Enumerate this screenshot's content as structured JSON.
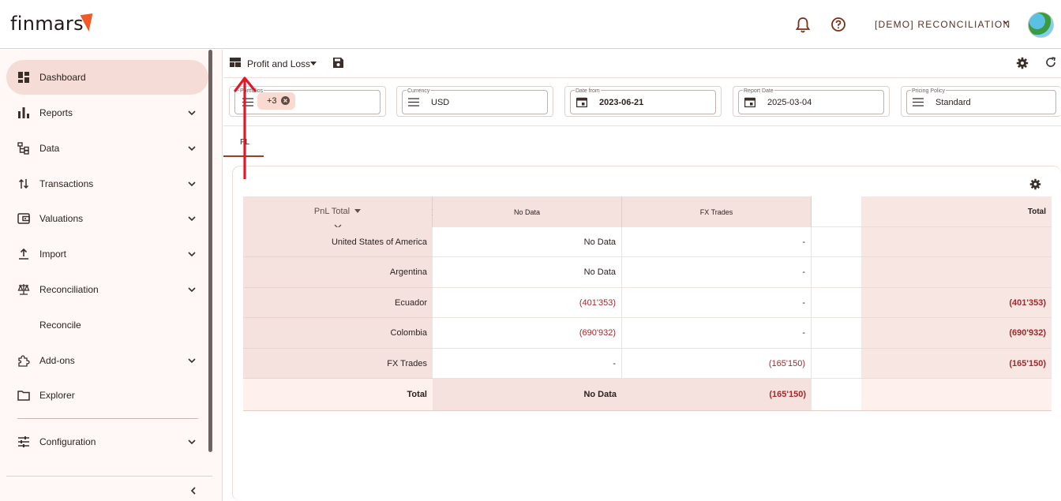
{
  "header": {
    "logo_text": "finmars",
    "space_name": "[DEMO] RECONCILIATION",
    "icons": [
      "bell-icon",
      "help-icon",
      "chevron-down-icon"
    ]
  },
  "sidebar": {
    "items": [
      {
        "label": "Dashboard",
        "icon": "dashboard-icon",
        "active": true,
        "expandable": false
      },
      {
        "label": "Reports",
        "icon": "bar-chart-icon",
        "active": false,
        "expandable": true
      },
      {
        "label": "Data",
        "icon": "tree-icon",
        "active": false,
        "expandable": true
      },
      {
        "label": "Transactions",
        "icon": "swap-vertical-icon",
        "active": false,
        "expandable": true
      },
      {
        "label": "Valuations",
        "icon": "wallet-icon",
        "active": false,
        "expandable": true
      },
      {
        "label": "Import",
        "icon": "upload-icon",
        "active": false,
        "expandable": true
      },
      {
        "label": "Reconciliation",
        "icon": "scale-icon",
        "active": false,
        "expandable": true
      },
      {
        "label": "Reconcile",
        "icon": "",
        "active": false,
        "expandable": false
      },
      {
        "label": "Add-ons",
        "icon": "puzzle-icon",
        "active": false,
        "expandable": true
      },
      {
        "label": "Explorer",
        "icon": "folder-icon",
        "active": false,
        "expandable": false
      },
      {
        "label": "Configuration",
        "icon": "tune-icon",
        "active": false,
        "expandable": true
      }
    ]
  },
  "toolbar": {
    "layout_name": "Profit and Loss"
  },
  "filters": {
    "portfolios": {
      "label": "Portfolios",
      "chip": "+3"
    },
    "currency": {
      "label": "Currency",
      "value": "USD"
    },
    "date_from": {
      "label": "Date from",
      "value": "2023-06-21"
    },
    "report_date": {
      "label": "Report Date",
      "value": "2025-03-04"
    },
    "pricing_policy": {
      "label": "Pricing Policy",
      "value": "Standard"
    }
  },
  "tabs": [
    {
      "label": "PL"
    }
  ],
  "pivot": {
    "row_header": "PnL Total",
    "columns": [
      "No Data",
      "FX Trades",
      "Total"
    ],
    "rows": [
      {
        "label": "United States of America",
        "values": [
          "No Data",
          "-",
          ""
        ]
      },
      {
        "label": "Argentina",
        "values": [
          "No Data",
          "-",
          ""
        ]
      },
      {
        "label": "Ecuador",
        "values": [
          "(401'353)",
          "-",
          "(401'353)"
        ]
      },
      {
        "label": "Colombia",
        "values": [
          "(690'932)",
          "-",
          "(690'932)"
        ]
      },
      {
        "label": "FX Trades",
        "values": [
          "-",
          "(165'150)",
          "(165'150)"
        ]
      }
    ],
    "footer": {
      "label": "Total",
      "values": [
        "No Data",
        "(165'150)",
        ""
      ]
    }
  },
  "colors": {
    "accent": "#f05a28",
    "active_nav": "#f5dcd6",
    "negative": "#a3282b",
    "annotation_arrow": "#e0182a"
  }
}
